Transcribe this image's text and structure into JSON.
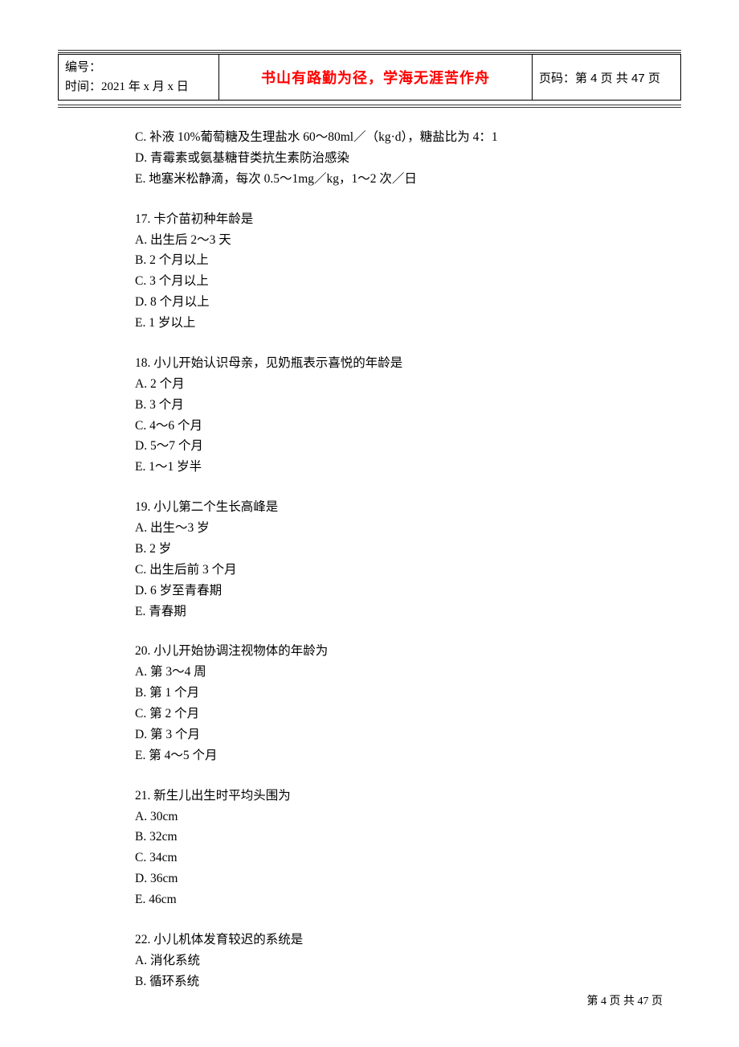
{
  "header": {
    "left_line1": "编号：",
    "left_line2": "时间：2021 年 x 月 x 日",
    "center": "书山有路勤为径，学海无涯苦作舟",
    "right": "页码：第 4 页  共 47 页"
  },
  "lead_options": [
    "C. 补液 10%葡萄糖及生理盐水 60～80ml／（kg·d），糖盐比为 4：1",
    "D. 青霉素或氨基糖苷类抗生素防治感染",
    "E. 地塞米松静滴，每次 0.5～1mg／kg，1～2 次／日"
  ],
  "questions": [
    {
      "stem": "17. 卡介苗初种年龄是",
      "options": [
        "A. 出生后 2～3 天",
        "B. 2 个月以上",
        "C. 3 个月以上",
        "D. 8 个月以上",
        "E. 1 岁以上"
      ]
    },
    {
      "stem": "18. 小儿开始认识母亲，见奶瓶表示喜悦的年龄是",
      "options": [
        "A. 2 个月",
        "B. 3 个月",
        "C. 4～6 个月",
        "D. 5～7 个月",
        "E. 1～1 岁半"
      ]
    },
    {
      "stem": "19. 小儿第二个生长高峰是",
      "options": [
        "A. 出生～3 岁",
        "B. 2 岁",
        "C. 出生后前 3 个月",
        "D. 6 岁至青春期",
        "E. 青春期"
      ]
    },
    {
      "stem": "20. 小儿开始协调注视物体的年龄为",
      "options": [
        "A. 第 3～4 周",
        "B. 第 1 个月",
        "C. 第 2 个月",
        "D. 第 3 个月",
        "E. 第 4～5 个月"
      ]
    },
    {
      "stem": "21. 新生儿出生时平均头围为",
      "options": [
        "A. 30cm",
        "B. 32cm",
        "C. 34cm",
        "D. 36cm",
        "E. 46cm"
      ]
    },
    {
      "stem": "22. 小儿机体发育较迟的系统是",
      "options": [
        "A. 消化系统",
        "B. 循环系统"
      ]
    }
  ],
  "footer": "第 4 页 共 47 页"
}
